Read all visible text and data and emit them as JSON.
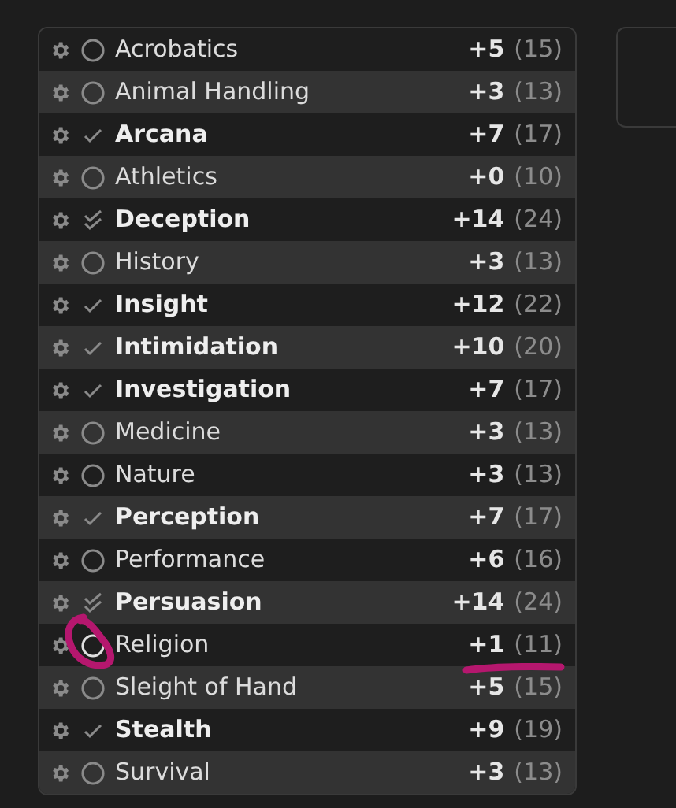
{
  "skills": [
    {
      "name": "Acrobatics",
      "proficient": false,
      "expertise": false,
      "modifier": "+5",
      "passive": "(15)",
      "annotated": false
    },
    {
      "name": "Animal Handling",
      "proficient": false,
      "expertise": false,
      "modifier": "+3",
      "passive": "(13)",
      "annotated": false
    },
    {
      "name": "Arcana",
      "proficient": true,
      "expertise": false,
      "modifier": "+7",
      "passive": "(17)",
      "annotated": false
    },
    {
      "name": "Athletics",
      "proficient": false,
      "expertise": false,
      "modifier": "+0",
      "passive": "(10)",
      "annotated": false
    },
    {
      "name": "Deception",
      "proficient": true,
      "expertise": true,
      "modifier": "+14",
      "passive": "(24)",
      "annotated": false
    },
    {
      "name": "History",
      "proficient": false,
      "expertise": false,
      "modifier": "+3",
      "passive": "(13)",
      "annotated": false
    },
    {
      "name": "Insight",
      "proficient": true,
      "expertise": false,
      "modifier": "+12",
      "passive": "(22)",
      "annotated": false
    },
    {
      "name": "Intimidation",
      "proficient": true,
      "expertise": false,
      "modifier": "+10",
      "passive": "(20)",
      "annotated": false
    },
    {
      "name": "Investigation",
      "proficient": true,
      "expertise": false,
      "modifier": "+7",
      "passive": "(17)",
      "annotated": false
    },
    {
      "name": "Medicine",
      "proficient": false,
      "expertise": false,
      "modifier": "+3",
      "passive": "(13)",
      "annotated": false
    },
    {
      "name": "Nature",
      "proficient": false,
      "expertise": false,
      "modifier": "+3",
      "passive": "(13)",
      "annotated": false
    },
    {
      "name": "Perception",
      "proficient": true,
      "expertise": false,
      "modifier": "+7",
      "passive": "(17)",
      "annotated": false
    },
    {
      "name": "Performance",
      "proficient": false,
      "expertise": false,
      "modifier": "+6",
      "passive": "(16)",
      "annotated": false
    },
    {
      "name": "Persuasion",
      "proficient": true,
      "expertise": true,
      "modifier": "+14",
      "passive": "(24)",
      "annotated": false
    },
    {
      "name": "Religion",
      "proficient": false,
      "expertise": false,
      "modifier": "+1",
      "passive": "(11)",
      "annotated": true
    },
    {
      "name": "Sleight of Hand",
      "proficient": false,
      "expertise": false,
      "modifier": "+5",
      "passive": "(15)",
      "annotated": false
    },
    {
      "name": "Stealth",
      "proficient": true,
      "expertise": false,
      "modifier": "+9",
      "passive": "(19)",
      "annotated": false
    },
    {
      "name": "Survival",
      "proficient": false,
      "expertise": false,
      "modifier": "+3",
      "passive": "(13)",
      "annotated": false
    }
  ]
}
